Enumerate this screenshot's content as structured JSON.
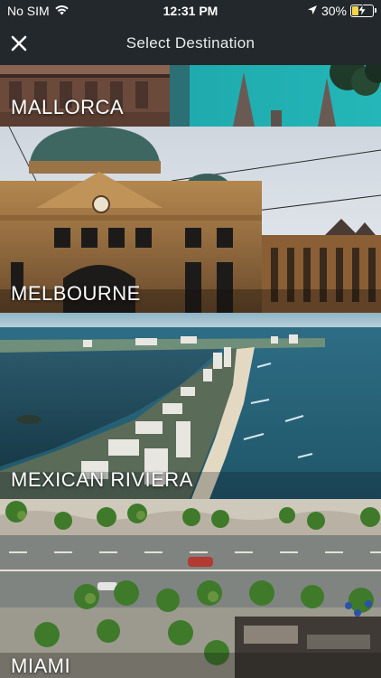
{
  "status_bar": {
    "carrier": "No SIM",
    "time": "12:31 PM",
    "battery_percent": "30%",
    "battery_level": 0.3,
    "icons": [
      "wifi-icon",
      "location-arrow-icon",
      "battery-charging-icon"
    ]
  },
  "nav": {
    "title": "Select Destination",
    "close_icon": "close-icon"
  },
  "destinations": [
    {
      "name": "MALLORCA"
    },
    {
      "name": "MELBOURNE"
    },
    {
      "name": "MEXICAN RIVIERA"
    },
    {
      "name": "MIAMI"
    }
  ],
  "colors": {
    "bar_background": "#22282b",
    "text": "#ffffff",
    "battery_fill": "#f6d34b"
  }
}
